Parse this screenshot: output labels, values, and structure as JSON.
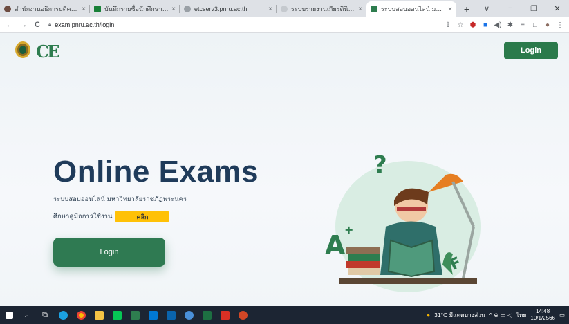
{
  "browser": {
    "tabs": [
      {
        "title": "สำนักงานอธิการบดีคอมพิวเตอร์",
        "favicon_color": "#6d4c41"
      },
      {
        "title": "บันทึกรายชื่อนักศึกษาเรียนตลอด",
        "favicon_color": "#188038"
      },
      {
        "title": "etcserv3.pnru.ac.th",
        "favicon_color": "#9aa0a6"
      },
      {
        "title": "ระบบรายงานเกียรตินิยม - มหาวิทยาลัย",
        "favicon_color": "#c5c9ce"
      },
      {
        "title": "ระบบสอบออนไลน์ มหาวิทยาลัย",
        "favicon_color": "#2e7d4f"
      }
    ],
    "close_glyph": "×",
    "new_tab_glyph": "+",
    "window_controls": [
      "∨",
      "−",
      "❐",
      "✕"
    ],
    "nav": {
      "back": "←",
      "forward": "→",
      "reload": "C"
    },
    "url": "exam.pnru.ac.th/login",
    "lock_icon": "lock-icon",
    "toolbar_icons": [
      "share",
      "star",
      "shield",
      "extension",
      "extension",
      "puzzle",
      "list",
      "sidebar",
      "avatar",
      "menu"
    ]
  },
  "page": {
    "nav_login_label": "Login",
    "hero_title": "Online Exams",
    "hero_subtitle": "ระบบสอบออนไลน์ มหาวิทยาลัยราชภัฏพระนคร",
    "manual_label": "ศึกษาคู่มือการใช้งาน",
    "manual_button": "คลิก",
    "login_button": "Login",
    "accent_color": "#2b7a4b",
    "manual_button_color": "#ffc107",
    "title_color": "#1f3b5a"
  },
  "taskbar": {
    "apps": [
      "windows-start",
      "search",
      "task-view",
      "edge",
      "chrome",
      "file-explorer",
      "line",
      "calendar",
      "mail",
      "outlook",
      "settings",
      "excel",
      "acrobat",
      "powerpoint"
    ],
    "weather": "31°C มีแดดบางส่วน",
    "tray_icons": "^ ⊕ ▭ ◁",
    "language": "ไทย",
    "time": "14:48",
    "date": "10/1/2566"
  }
}
